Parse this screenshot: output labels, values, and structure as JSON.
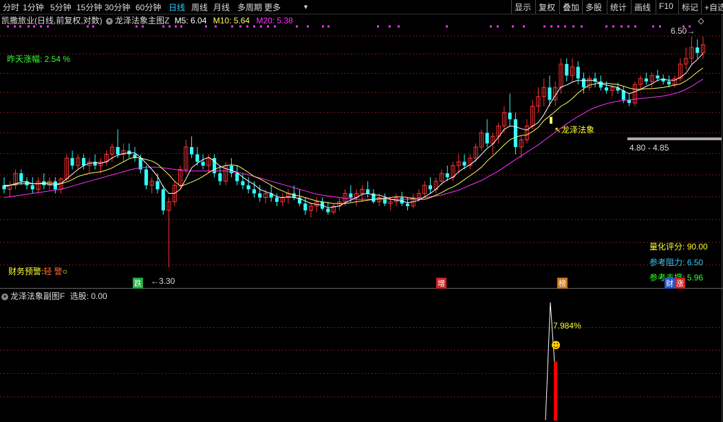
{
  "toolbar": {
    "left_items": [
      "分时",
      "1分钟",
      "5分钟",
      "15分钟",
      "30分钟",
      "60分钟",
      "日线",
      "周线",
      "月线",
      "多周期",
      "更多"
    ],
    "active": "日线",
    "right_items": [
      "显示",
      "复权",
      "叠加",
      "多股",
      "统计",
      "画线",
      "F10",
      "标记",
      "+自选"
    ]
  },
  "main_header": {
    "stock": "凯撒旅业(日线,前复权,对数)",
    "indicator": "龙泽法象主图Z",
    "m5": "M5: 6.04",
    "m10": "M10: 5.64",
    "m20": "M20: 5.38"
  },
  "annotations": {
    "prev_change": "昨天涨幅: 2.54 %",
    "finance_warning": "财务预警:",
    "warning_level": "轻 警",
    "low_label": "3.30",
    "high_label": "6.50",
    "range_label": "4.80 - 4.85",
    "signal_label": "龙泽法象",
    "score_label": "量化评分:",
    "score_value": "90.00",
    "resist_label": "参考阻力:",
    "resist_value": "6.50",
    "support_label": "参考支撑:",
    "support_value": "5.96",
    "tags": [
      "跌",
      "增",
      "榜",
      "财",
      "涨"
    ]
  },
  "sub_header": {
    "indicator": "龙泽法象副图F",
    "select_label": "选股: 0.00"
  },
  "sub_annotations": {
    "pct_label": "7.984%"
  },
  "colors": {
    "up": "#ff3333",
    "down": "#33ffff",
    "m5": "#ffffff",
    "m10": "#ffff66",
    "m20": "#ff33ff",
    "grid": "#7a1a1a",
    "accent": "#ffff00"
  },
  "chart_data": {
    "type": "candlestick",
    "scale": "log",
    "ylim": [
      3.2,
      6.6
    ],
    "candles": [
      {
        "o": 4.2,
        "h": 4.3,
        "l": 4.1,
        "c": 4.15
      },
      {
        "o": 4.15,
        "h": 4.25,
        "l": 4.05,
        "c": 4.2
      },
      {
        "o": 4.2,
        "h": 4.4,
        "l": 4.15,
        "c": 4.35
      },
      {
        "o": 4.35,
        "h": 4.4,
        "l": 4.2,
        "c": 4.25
      },
      {
        "o": 4.25,
        "h": 4.3,
        "l": 4.15,
        "c": 4.2
      },
      {
        "o": 4.2,
        "h": 4.3,
        "l": 4.1,
        "c": 4.15
      },
      {
        "o": 4.15,
        "h": 4.3,
        "l": 4.1,
        "c": 4.25
      },
      {
        "o": 4.25,
        "h": 4.35,
        "l": 4.15,
        "c": 4.2
      },
      {
        "o": 4.2,
        "h": 4.3,
        "l": 4.15,
        "c": 4.25
      },
      {
        "o": 4.25,
        "h": 4.3,
        "l": 4.1,
        "c": 4.15
      },
      {
        "o": 4.15,
        "h": 4.3,
        "l": 4.1,
        "c": 4.28
      },
      {
        "o": 4.28,
        "h": 4.6,
        "l": 4.25,
        "c": 4.55
      },
      {
        "o": 4.55,
        "h": 4.65,
        "l": 4.4,
        "c": 4.45
      },
      {
        "o": 4.45,
        "h": 4.6,
        "l": 4.4,
        "c": 4.55
      },
      {
        "o": 4.55,
        "h": 4.6,
        "l": 4.4,
        "c": 4.45
      },
      {
        "o": 4.45,
        "h": 4.55,
        "l": 4.35,
        "c": 4.5
      },
      {
        "o": 4.5,
        "h": 4.6,
        "l": 4.4,
        "c": 4.45
      },
      {
        "o": 4.45,
        "h": 4.55,
        "l": 4.35,
        "c": 4.5
      },
      {
        "o": 4.5,
        "h": 4.65,
        "l": 4.45,
        "c": 4.6
      },
      {
        "o": 4.6,
        "h": 4.75,
        "l": 4.5,
        "c": 4.7
      },
      {
        "o": 4.7,
        "h": 4.95,
        "l": 4.55,
        "c": 4.6
      },
      {
        "o": 4.6,
        "h": 4.75,
        "l": 4.5,
        "c": 4.65
      },
      {
        "o": 4.65,
        "h": 4.75,
        "l": 4.55,
        "c": 4.6
      },
      {
        "o": 4.6,
        "h": 4.7,
        "l": 4.5,
        "c": 4.55
      },
      {
        "o": 4.55,
        "h": 4.6,
        "l": 4.35,
        "c": 4.4
      },
      {
        "o": 4.4,
        "h": 4.45,
        "l": 4.15,
        "c": 4.2
      },
      {
        "o": 4.2,
        "h": 4.3,
        "l": 4.1,
        "c": 4.25
      },
      {
        "o": 4.25,
        "h": 4.35,
        "l": 4.1,
        "c": 4.15
      },
      {
        "o": 4.15,
        "h": 4.2,
        "l": 3.85,
        "c": 3.9
      },
      {
        "o": 3.9,
        "h": 4.05,
        "l": 3.3,
        "c": 4.0
      },
      {
        "o": 4.0,
        "h": 4.25,
        "l": 3.95,
        "c": 4.2
      },
      {
        "o": 4.2,
        "h": 4.45,
        "l": 4.15,
        "c": 4.4
      },
      {
        "o": 4.4,
        "h": 4.8,
        "l": 4.35,
        "c": 4.7
      },
      {
        "o": 4.7,
        "h": 4.85,
        "l": 4.55,
        "c": 4.6
      },
      {
        "o": 4.6,
        "h": 4.7,
        "l": 4.45,
        "c": 4.5
      },
      {
        "o": 4.5,
        "h": 4.6,
        "l": 4.4,
        "c": 4.45
      },
      {
        "o": 4.45,
        "h": 4.6,
        "l": 4.35,
        "c": 4.55
      },
      {
        "o": 4.55,
        "h": 4.6,
        "l": 4.3,
        "c": 4.35
      },
      {
        "o": 4.35,
        "h": 4.45,
        "l": 4.2,
        "c": 4.25
      },
      {
        "o": 4.25,
        "h": 4.5,
        "l": 4.2,
        "c": 4.45
      },
      {
        "o": 4.45,
        "h": 4.55,
        "l": 4.3,
        "c": 4.35
      },
      {
        "o": 4.35,
        "h": 4.45,
        "l": 4.2,
        "c": 4.25
      },
      {
        "o": 4.25,
        "h": 4.35,
        "l": 4.15,
        "c": 4.2
      },
      {
        "o": 4.2,
        "h": 4.3,
        "l": 4.1,
        "c": 4.15
      },
      {
        "o": 4.15,
        "h": 4.25,
        "l": 4.05,
        "c": 4.1
      },
      {
        "o": 4.1,
        "h": 4.2,
        "l": 4.0,
        "c": 4.05
      },
      {
        "o": 4.05,
        "h": 4.15,
        "l": 3.98,
        "c": 4.1
      },
      {
        "o": 4.1,
        "h": 4.2,
        "l": 4.0,
        "c": 4.05
      },
      {
        "o": 4.05,
        "h": 4.1,
        "l": 3.95,
        "c": 4.0
      },
      {
        "o": 4.0,
        "h": 4.1,
        "l": 3.95,
        "c": 4.05
      },
      {
        "o": 4.05,
        "h": 4.15,
        "l": 3.98,
        "c": 4.1
      },
      {
        "o": 4.1,
        "h": 4.2,
        "l": 4.02,
        "c": 4.05
      },
      {
        "o": 4.05,
        "h": 4.15,
        "l": 3.95,
        "c": 3.98
      },
      {
        "o": 3.98,
        "h": 4.05,
        "l": 3.85,
        "c": 3.9
      },
      {
        "o": 3.9,
        "h": 4.0,
        "l": 3.82,
        "c": 3.95
      },
      {
        "o": 3.95,
        "h": 4.05,
        "l": 3.88,
        "c": 4.0
      },
      {
        "o": 4.0,
        "h": 4.05,
        "l": 3.9,
        "c": 3.92
      },
      {
        "o": 3.92,
        "h": 4.0,
        "l": 3.85,
        "c": 3.88
      },
      {
        "o": 3.88,
        "h": 3.98,
        "l": 3.85,
        "c": 3.95
      },
      {
        "o": 3.95,
        "h": 4.05,
        "l": 3.9,
        "c": 4.0
      },
      {
        "o": 4.0,
        "h": 4.15,
        "l": 3.95,
        "c": 4.1
      },
      {
        "o": 4.1,
        "h": 4.2,
        "l": 4.0,
        "c": 4.05
      },
      {
        "o": 4.05,
        "h": 4.15,
        "l": 3.95,
        "c": 4.1
      },
      {
        "o": 4.1,
        "h": 4.2,
        "l": 4.0,
        "c": 4.15
      },
      {
        "o": 4.15,
        "h": 4.25,
        "l": 4.05,
        "c": 4.1
      },
      {
        "o": 4.1,
        "h": 4.15,
        "l": 3.98,
        "c": 4.0
      },
      {
        "o": 4.0,
        "h": 4.1,
        "l": 3.95,
        "c": 4.05
      },
      {
        "o": 4.05,
        "h": 4.1,
        "l": 3.95,
        "c": 3.98
      },
      {
        "o": 3.98,
        "h": 4.05,
        "l": 3.9,
        "c": 4.0
      },
      {
        "o": 4.0,
        "h": 4.1,
        "l": 3.95,
        "c": 4.05
      },
      {
        "o": 4.05,
        "h": 4.12,
        "l": 3.95,
        "c": 3.98
      },
      {
        "o": 3.98,
        "h": 4.05,
        "l": 3.9,
        "c": 3.95
      },
      {
        "o": 3.95,
        "h": 4.1,
        "l": 3.92,
        "c": 4.05
      },
      {
        "o": 4.05,
        "h": 4.15,
        "l": 4.0,
        "c": 4.1
      },
      {
        "o": 4.1,
        "h": 4.25,
        "l": 4.05,
        "c": 4.2
      },
      {
        "o": 4.2,
        "h": 4.3,
        "l": 4.1,
        "c": 4.15
      },
      {
        "o": 4.15,
        "h": 4.3,
        "l": 4.1,
        "c": 4.25
      },
      {
        "o": 4.25,
        "h": 4.4,
        "l": 4.2,
        "c": 4.35
      },
      {
        "o": 4.35,
        "h": 4.45,
        "l": 4.25,
        "c": 4.3
      },
      {
        "o": 4.3,
        "h": 4.5,
        "l": 4.25,
        "c": 4.45
      },
      {
        "o": 4.45,
        "h": 4.6,
        "l": 4.35,
        "c": 4.5
      },
      {
        "o": 4.5,
        "h": 4.6,
        "l": 4.4,
        "c": 4.45
      },
      {
        "o": 4.45,
        "h": 4.6,
        "l": 4.4,
        "c": 4.55
      },
      {
        "o": 4.55,
        "h": 4.75,
        "l": 4.5,
        "c": 4.7
      },
      {
        "o": 4.7,
        "h": 4.95,
        "l": 4.65,
        "c": 4.9
      },
      {
        "o": 4.9,
        "h": 5.1,
        "l": 4.7,
        "c": 4.75
      },
      {
        "o": 4.75,
        "h": 4.9,
        "l": 4.6,
        "c": 4.85
      },
      {
        "o": 4.85,
        "h": 5.05,
        "l": 4.75,
        "c": 5.0
      },
      {
        "o": 5.0,
        "h": 5.3,
        "l": 4.9,
        "c": 5.2
      },
      {
        "o": 5.2,
        "h": 5.5,
        "l": 5.0,
        "c": 5.1
      },
      {
        "o": 5.1,
        "h": 5.2,
        "l": 4.6,
        "c": 4.7
      },
      {
        "o": 4.7,
        "h": 4.85,
        "l": 4.55,
        "c": 4.8
      },
      {
        "o": 4.8,
        "h": 5.1,
        "l": 4.75,
        "c": 5.0
      },
      {
        "o": 5.0,
        "h": 5.4,
        "l": 4.95,
        "c": 5.3
      },
      {
        "o": 5.3,
        "h": 5.6,
        "l": 5.2,
        "c": 5.45
      },
      {
        "o": 5.45,
        "h": 5.75,
        "l": 5.3,
        "c": 5.6
      },
      {
        "o": 5.6,
        "h": 5.8,
        "l": 5.3,
        "c": 5.4
      },
      {
        "o": 5.4,
        "h": 5.7,
        "l": 5.3,
        "c": 5.6
      },
      {
        "o": 5.6,
        "h": 6.1,
        "l": 5.5,
        "c": 6.0
      },
      {
        "o": 6.0,
        "h": 6.1,
        "l": 5.7,
        "c": 5.8
      },
      {
        "o": 5.8,
        "h": 6.1,
        "l": 5.7,
        "c": 5.95
      },
      {
        "o": 5.95,
        "h": 6.05,
        "l": 5.65,
        "c": 5.75
      },
      {
        "o": 5.75,
        "h": 5.85,
        "l": 5.5,
        "c": 5.6
      },
      {
        "o": 5.6,
        "h": 5.8,
        "l": 5.55,
        "c": 5.75
      },
      {
        "o": 5.75,
        "h": 5.85,
        "l": 5.6,
        "c": 5.7
      },
      {
        "o": 5.7,
        "h": 5.8,
        "l": 5.55,
        "c": 5.6
      },
      {
        "o": 5.6,
        "h": 5.7,
        "l": 5.5,
        "c": 5.55
      },
      {
        "o": 5.55,
        "h": 5.65,
        "l": 5.45,
        "c": 5.6
      },
      {
        "o": 5.6,
        "h": 5.68,
        "l": 5.5,
        "c": 5.55
      },
      {
        "o": 5.55,
        "h": 5.62,
        "l": 5.35,
        "c": 5.4
      },
      {
        "o": 5.4,
        "h": 5.5,
        "l": 5.3,
        "c": 5.35
      },
      {
        "o": 5.35,
        "h": 5.7,
        "l": 5.3,
        "c": 5.65
      },
      {
        "o": 5.65,
        "h": 5.8,
        "l": 5.55,
        "c": 5.75
      },
      {
        "o": 5.75,
        "h": 5.85,
        "l": 5.65,
        "c": 5.7
      },
      {
        "o": 5.7,
        "h": 5.85,
        "l": 5.6,
        "c": 5.8
      },
      {
        "o": 5.8,
        "h": 5.9,
        "l": 5.7,
        "c": 5.75
      },
      {
        "o": 5.75,
        "h": 5.82,
        "l": 5.65,
        "c": 5.7
      },
      {
        "o": 5.7,
        "h": 5.8,
        "l": 5.6,
        "c": 5.65
      },
      {
        "o": 5.65,
        "h": 5.8,
        "l": 5.6,
        "c": 5.75
      },
      {
        "o": 5.75,
        "h": 6.1,
        "l": 5.7,
        "c": 6.0
      },
      {
        "o": 6.0,
        "h": 6.3,
        "l": 5.9,
        "c": 6.1
      },
      {
        "o": 6.1,
        "h": 6.5,
        "l": 6.0,
        "c": 6.3
      },
      {
        "o": 6.3,
        "h": 6.45,
        "l": 6.1,
        "c": 6.2
      },
      {
        "o": 6.2,
        "h": 6.5,
        "l": 6.1,
        "c": 6.35
      }
    ],
    "ma5": [
      4.18,
      4.2,
      4.22,
      4.24,
      4.24,
      4.22,
      4.22,
      4.22,
      4.21,
      4.2,
      4.22,
      4.28,
      4.34,
      4.4,
      4.45,
      4.48,
      4.49,
      4.48,
      4.5,
      4.55,
      4.59,
      4.61,
      4.62,
      4.62,
      4.56,
      4.48,
      4.4,
      4.31,
      4.18,
      4.1,
      4.1,
      4.15,
      4.28,
      4.42,
      4.48,
      4.53,
      4.56,
      4.51,
      4.44,
      4.41,
      4.39,
      4.36,
      4.3,
      4.25,
      4.21,
      4.15,
      4.12,
      4.1,
      4.06,
      4.05,
      4.06,
      4.05,
      4.04,
      4.01,
      3.98,
      3.97,
      3.96,
      3.93,
      3.94,
      3.95,
      3.99,
      4.02,
      4.05,
      4.09,
      4.1,
      4.08,
      4.08,
      4.06,
      4.03,
      4.02,
      4.01,
      3.99,
      4.0,
      4.02,
      4.06,
      4.1,
      4.15,
      4.22,
      4.27,
      4.3,
      4.37,
      4.42,
      4.46,
      4.52,
      4.6,
      4.68,
      4.74,
      4.84,
      4.95,
      5.0,
      4.99,
      4.96,
      4.94,
      5.0,
      5.05,
      5.17,
      5.33,
      5.47,
      5.61,
      5.64,
      5.69,
      5.72,
      5.71,
      5.72,
      5.71,
      5.66,
      5.64,
      5.62,
      5.6,
      5.54,
      5.5,
      5.53,
      5.57,
      5.62,
      5.66,
      5.72,
      5.74,
      5.72,
      5.72,
      5.77,
      5.84,
      5.99,
      6.08,
      6.19
    ],
    "ma10": [
      4.2,
      4.2,
      4.21,
      4.22,
      4.22,
      4.22,
      4.22,
      4.23,
      4.23,
      4.22,
      4.22,
      4.24,
      4.27,
      4.31,
      4.33,
      4.35,
      4.36,
      4.37,
      4.39,
      4.42,
      4.46,
      4.5,
      4.54,
      4.56,
      4.55,
      4.53,
      4.51,
      4.47,
      4.4,
      4.33,
      4.25,
      4.19,
      4.21,
      4.24,
      4.27,
      4.31,
      4.36,
      4.4,
      4.43,
      4.45,
      4.46,
      4.45,
      4.41,
      4.36,
      4.31,
      4.28,
      4.24,
      4.2,
      4.16,
      4.13,
      4.1,
      4.08,
      4.07,
      4.05,
      4.03,
      4.01,
      4.0,
      3.99,
      3.98,
      3.98,
      3.98,
      3.99,
      4.0,
      4.01,
      4.02,
      4.03,
      4.04,
      4.04,
      4.05,
      4.06,
      4.06,
      4.05,
      4.04,
      4.03,
      4.03,
      4.05,
      4.08,
      4.11,
      4.15,
      4.18,
      4.22,
      4.27,
      4.32,
      4.37,
      4.43,
      4.51,
      4.58,
      4.65,
      4.73,
      4.8,
      4.84,
      4.86,
      4.87,
      4.92,
      4.98,
      5.08,
      5.15,
      5.22,
      5.3,
      5.35,
      5.42,
      5.51,
      5.58,
      5.64,
      5.66,
      5.67,
      5.67,
      5.66,
      5.65,
      5.62,
      5.59,
      5.57,
      5.57,
      5.58,
      5.58,
      5.59,
      5.6,
      5.62,
      5.64,
      5.66,
      5.71,
      5.78,
      5.86,
      5.93
    ],
    "ma20": [
      4.05,
      4.06,
      4.07,
      4.08,
      4.09,
      4.1,
      4.11,
      4.12,
      4.13,
      4.14,
      4.15,
      4.17,
      4.19,
      4.21,
      4.23,
      4.25,
      4.27,
      4.29,
      4.31,
      4.33,
      4.35,
      4.37,
      4.39,
      4.41,
      4.42,
      4.43,
      4.43,
      4.43,
      4.42,
      4.41,
      4.4,
      4.39,
      4.38,
      4.38,
      4.38,
      4.38,
      4.38,
      4.38,
      4.38,
      4.38,
      4.37,
      4.36,
      4.35,
      4.33,
      4.31,
      4.29,
      4.27,
      4.25,
      4.23,
      4.21,
      4.19,
      4.17,
      4.15,
      4.13,
      4.11,
      4.09,
      4.08,
      4.07,
      4.06,
      4.05,
      4.04,
      4.04,
      4.03,
      4.03,
      4.03,
      4.03,
      4.03,
      4.03,
      4.03,
      4.03,
      4.03,
      4.03,
      4.03,
      4.04,
      4.05,
      4.06,
      4.07,
      4.08,
      4.1,
      4.12,
      4.14,
      4.17,
      4.2,
      4.23,
      4.26,
      4.3,
      4.34,
      4.38,
      4.43,
      4.48,
      4.53,
      4.58,
      4.63,
      4.68,
      4.73,
      4.79,
      4.85,
      4.91,
      4.97,
      5.03,
      5.09,
      5.14,
      5.19,
      5.24,
      5.28,
      5.31,
      5.34,
      5.36,
      5.38,
      5.39,
      5.4,
      5.41,
      5.42,
      5.43,
      5.44,
      5.45,
      5.46,
      5.48,
      5.5,
      5.53,
      5.57,
      5.62,
      5.68,
      5.74
    ],
    "markers_top_idx": [
      3,
      9,
      16,
      26,
      37,
      44,
      56,
      66,
      76,
      88,
      96,
      105,
      113,
      121
    ],
    "sub_chart": {
      "spike_value": 7.984,
      "bar_value": 0.6
    }
  }
}
